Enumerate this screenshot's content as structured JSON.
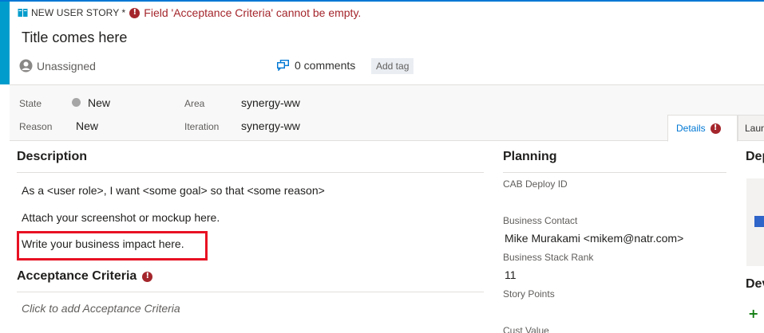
{
  "header": {
    "work_item_type": "NEW USER STORY *",
    "error_message": "Field 'Acceptance Criteria' cannot be empty.",
    "title": "Title comes here",
    "assignee": "Unassigned",
    "comments": "0 comments",
    "add_tag": "Add tag"
  },
  "fields": {
    "state_label": "State",
    "state_value": "New",
    "reason_label": "Reason",
    "reason_value": "New",
    "area_label": "Area",
    "area_value": "synergy-ww",
    "iteration_label": "Iteration",
    "iteration_value": "synergy-ww"
  },
  "tabs": [
    {
      "label": "Details",
      "active": true,
      "has_error": true
    },
    {
      "label": "Launc",
      "active": false
    }
  ],
  "description": {
    "title": "Description",
    "lines": [
      "As a <user role>, I want <some goal> so that <some reason>",
      "Attach your screenshot or mockup here.",
      "Write your business impact here."
    ]
  },
  "acceptance": {
    "title": "Acceptance Criteria",
    "placeholder": "Click to add Acceptance Criteria"
  },
  "planning": {
    "title": "Planning",
    "cab_deploy_label": "CAB Deploy ID",
    "business_contact_label": "Business Contact",
    "business_contact_value": "Mike Murakami <mikem@natr.com>",
    "stack_rank_label": "Business Stack Rank",
    "stack_rank_value": "11",
    "story_points_label": "Story Points",
    "cust_value_label": "Cust Value"
  },
  "right_column": {
    "deployment_title": "Dep",
    "development_title": "Dev",
    "add_label": "+"
  },
  "colors": {
    "accent": "#0078d4",
    "story_bar": "#009ccc",
    "error": "#a4262c",
    "highlight_box": "#e81123"
  }
}
